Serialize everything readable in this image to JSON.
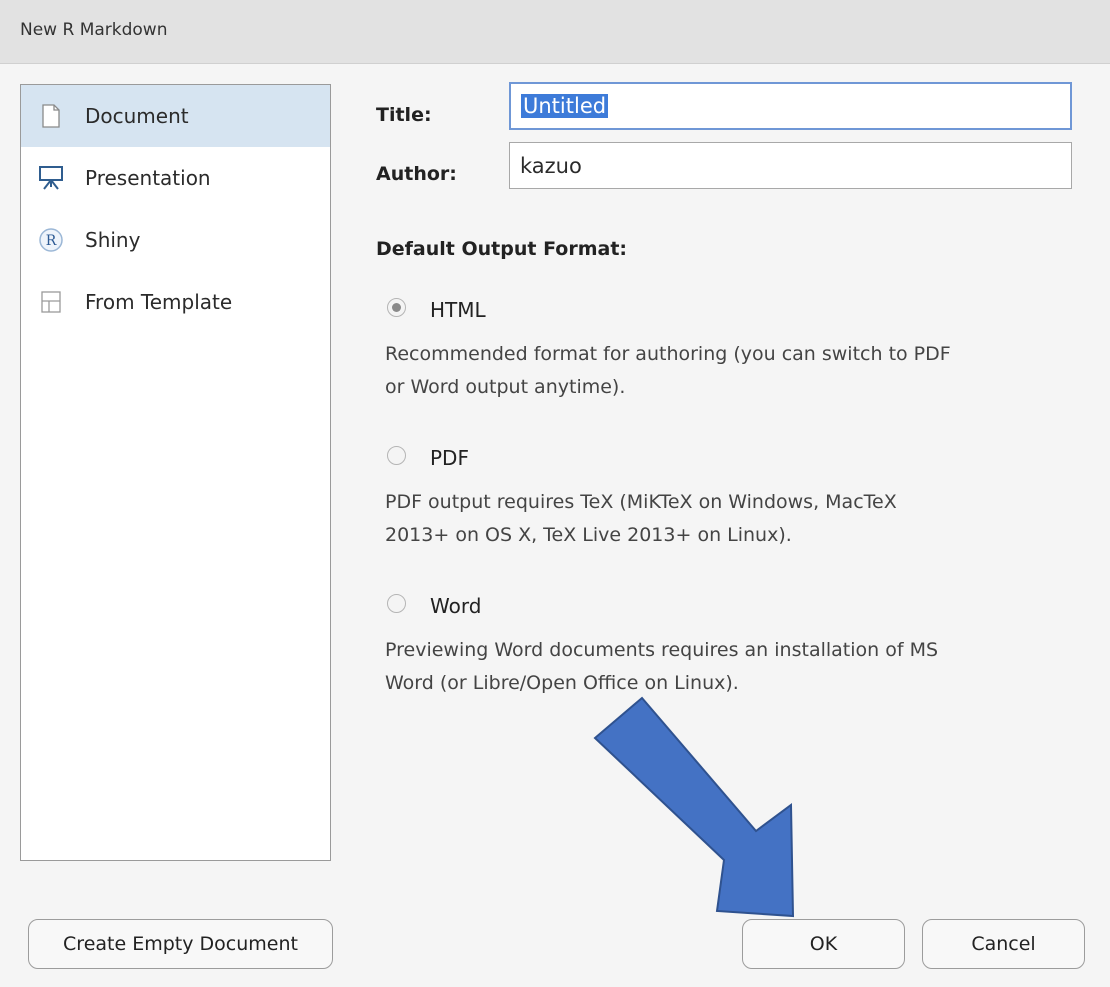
{
  "window": {
    "title": "New R Markdown"
  },
  "templates": [
    {
      "label": "Document",
      "icon": "document-icon",
      "selected": true
    },
    {
      "label": "Presentation",
      "icon": "presentation-icon",
      "selected": false
    },
    {
      "label": "Shiny",
      "icon": "r-shiny-icon",
      "selected": false
    },
    {
      "label": "From Template",
      "icon": "template-icon",
      "selected": false
    }
  ],
  "form": {
    "title_label": "Title:",
    "title_value": "Untitled",
    "author_label": "Author:",
    "author_value": "kazuo"
  },
  "output": {
    "heading": "Default Output Format:",
    "options": [
      {
        "label": "HTML",
        "checked": true,
        "desc_line1": "Recommended format for authoring (you can switch to PDF",
        "desc_line2": "or Word output anytime)."
      },
      {
        "label": "PDF",
        "checked": false,
        "desc_line1": "PDF output requires TeX (MiKTeX on Windows, MacTeX",
        "desc_line2": "2013+ on OS X, TeX Live 2013+ on Linux)."
      },
      {
        "label": "Word",
        "checked": false,
        "desc_line1": "Previewing Word documents requires an installation of MS",
        "desc_line2": "Word (or Libre/Open Office on Linux)."
      }
    ]
  },
  "buttons": {
    "create_empty": "Create Empty Document",
    "ok": "OK",
    "cancel": "Cancel"
  },
  "colors": {
    "selection": "#d6e4f1",
    "focus_border": "#6f97d6",
    "arrow": "#4472c4"
  }
}
